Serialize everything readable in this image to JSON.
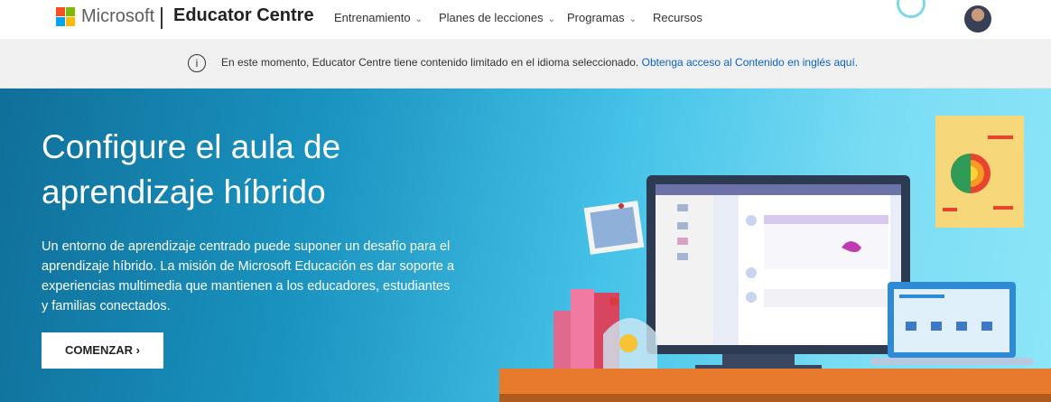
{
  "header": {
    "brand": "Microsoft",
    "site_name": "Educator Centre",
    "nav": [
      {
        "label": "Entrenamiento",
        "dropdown": true
      },
      {
        "label": "Planes de lecciones",
        "dropdown": true
      },
      {
        "label": "Programas",
        "dropdown": true
      },
      {
        "label": "Recursos",
        "dropdown": false
      }
    ],
    "chevron": "⌄"
  },
  "notice": {
    "icon": "i",
    "text": "En este momento, Educator Centre tiene contenido limitado en el idioma seleccionado.",
    "link": "Obtenga acceso al Contenido en inglés aquí."
  },
  "hero": {
    "title_line1": "Configure el aula de",
    "title_line2": "aprendizaje híbrido",
    "body": "Un entorno de aprendizaje centrado puede suponer un desafío para el aprendizaje híbrido. La misión de Microsoft Educación es dar soporte a experiencias multimedia que mantienen a los educadores, estudiantes y familias conectados.",
    "cta": "COMENZAR ›"
  },
  "colors": {
    "logo_red": "#f25022",
    "logo_green": "#7fba00",
    "logo_blue": "#00a4ef",
    "logo_yellow": "#ffb900",
    "link": "#0a63c9",
    "hero_dark": "#0f6f99",
    "hero_light": "#8de6f8",
    "desk": "#e87a2e"
  }
}
